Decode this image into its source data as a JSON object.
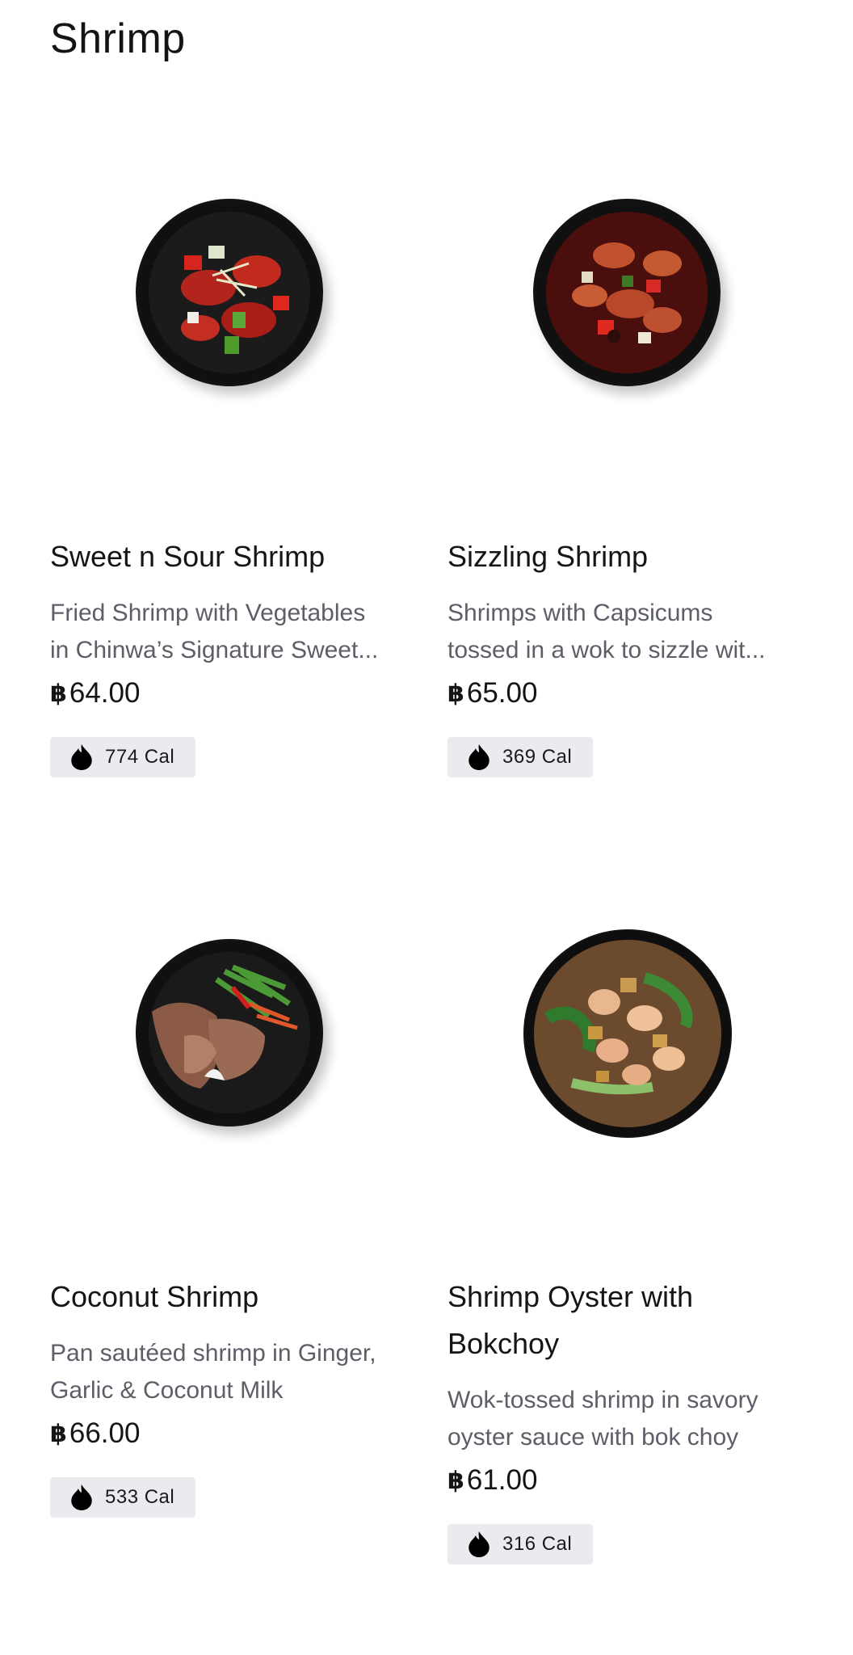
{
  "section": {
    "title": "Shrimp"
  },
  "currency_symbol": "฿",
  "items": [
    {
      "name": "Sweet n Sour Shrimp",
      "desc_line1": "Fried Shrimp with Vegetables",
      "desc_line2": "in Chinwa’s Signature Sweet...",
      "price": "64.00",
      "calories": "774 Cal"
    },
    {
      "name": "Sizzling Shrimp",
      "desc_line1": "Shrimps with Capsicums",
      "desc_line2": "tossed in a wok to sizzle wit...",
      "price": "65.00",
      "calories": "369 Cal"
    },
    {
      "name": "Coconut Shrimp",
      "desc_line1": "Pan sautéed shrimp in Ginger,",
      "desc_line2": "Garlic & Coconut Milk",
      "price": "66.00",
      "calories": "533 Cal"
    },
    {
      "name_line1": "Shrimp Oyster with",
      "name_line2": "Bokchoy",
      "desc_line1": "Wok-tossed shrimp in savory",
      "desc_line2": "oyster sauce with bok choy",
      "price": "61.00",
      "calories": "316 Cal"
    }
  ],
  "icons": {
    "calorie": "flame-drop-icon",
    "currency": "riyal-symbol-icon"
  }
}
